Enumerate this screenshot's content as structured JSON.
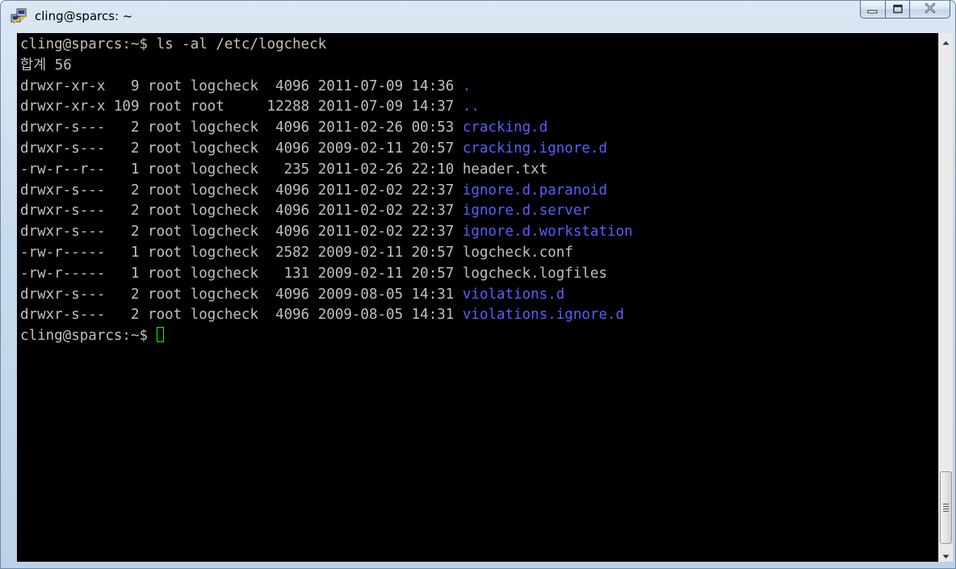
{
  "window": {
    "title": "cling@sparcs: ~"
  },
  "icons": {
    "app": "putty-icon",
    "minimize": "minimize-icon",
    "maximize": "maximize-icon",
    "close": "close-icon",
    "scroll_up": "arrow-up-icon",
    "scroll_down": "arrow-down-icon",
    "scroll_grip": "grip-icon"
  },
  "colors": {
    "terminal_bg": "#000000",
    "terminal_text": "#c0c0c0",
    "directory": "#5c5cff",
    "cursor": "#00ff00"
  },
  "terminal": {
    "lines": [
      {
        "text": "cling@sparcs:~$ ls -al /etc/logcheck"
      },
      {
        "text": "합계 56"
      },
      {
        "text": "drwxr-xr-x   9 root logcheck  4096 2011-07-09 14:36 ",
        "name": ".",
        "is_dir": true
      },
      {
        "text": "drwxr-xr-x 109 root root     12288 2011-07-09 14:37 ",
        "name": "..",
        "is_dir": true
      },
      {
        "text": "drwxr-s---   2 root logcheck  4096 2011-02-26 00:53 ",
        "name": "cracking.d",
        "is_dir": true
      },
      {
        "text": "drwxr-s---   2 root logcheck  4096 2009-02-11 20:57 ",
        "name": "cracking.ignore.d",
        "is_dir": true
      },
      {
        "text": "-rw-r--r--   1 root logcheck   235 2011-02-26 22:10 ",
        "name": "header.txt",
        "is_dir": false
      },
      {
        "text": "drwxr-s---   2 root logcheck  4096 2011-02-02 22:37 ",
        "name": "ignore.d.paranoid",
        "is_dir": true
      },
      {
        "text": "drwxr-s---   2 root logcheck  4096 2011-02-02 22:37 ",
        "name": "ignore.d.server",
        "is_dir": true
      },
      {
        "text": "drwxr-s---   2 root logcheck  4096 2011-02-02 22:37 ",
        "name": "ignore.d.workstation",
        "is_dir": true
      },
      {
        "text": "-rw-r-----   1 root logcheck  2582 2009-02-11 20:57 ",
        "name": "logcheck.conf",
        "is_dir": false
      },
      {
        "text": "-rw-r-----   1 root logcheck   131 2009-02-11 20:57 ",
        "name": "logcheck.logfiles",
        "is_dir": false
      },
      {
        "text": "drwxr-s---   2 root logcheck  4096 2009-08-05 14:31 ",
        "name": "violations.d",
        "is_dir": true
      },
      {
        "text": "drwxr-s---   2 root logcheck  4096 2009-08-05 14:31 ",
        "name": "violations.ignore.d",
        "is_dir": true
      }
    ],
    "prompt": "cling@sparcs:~$ "
  }
}
